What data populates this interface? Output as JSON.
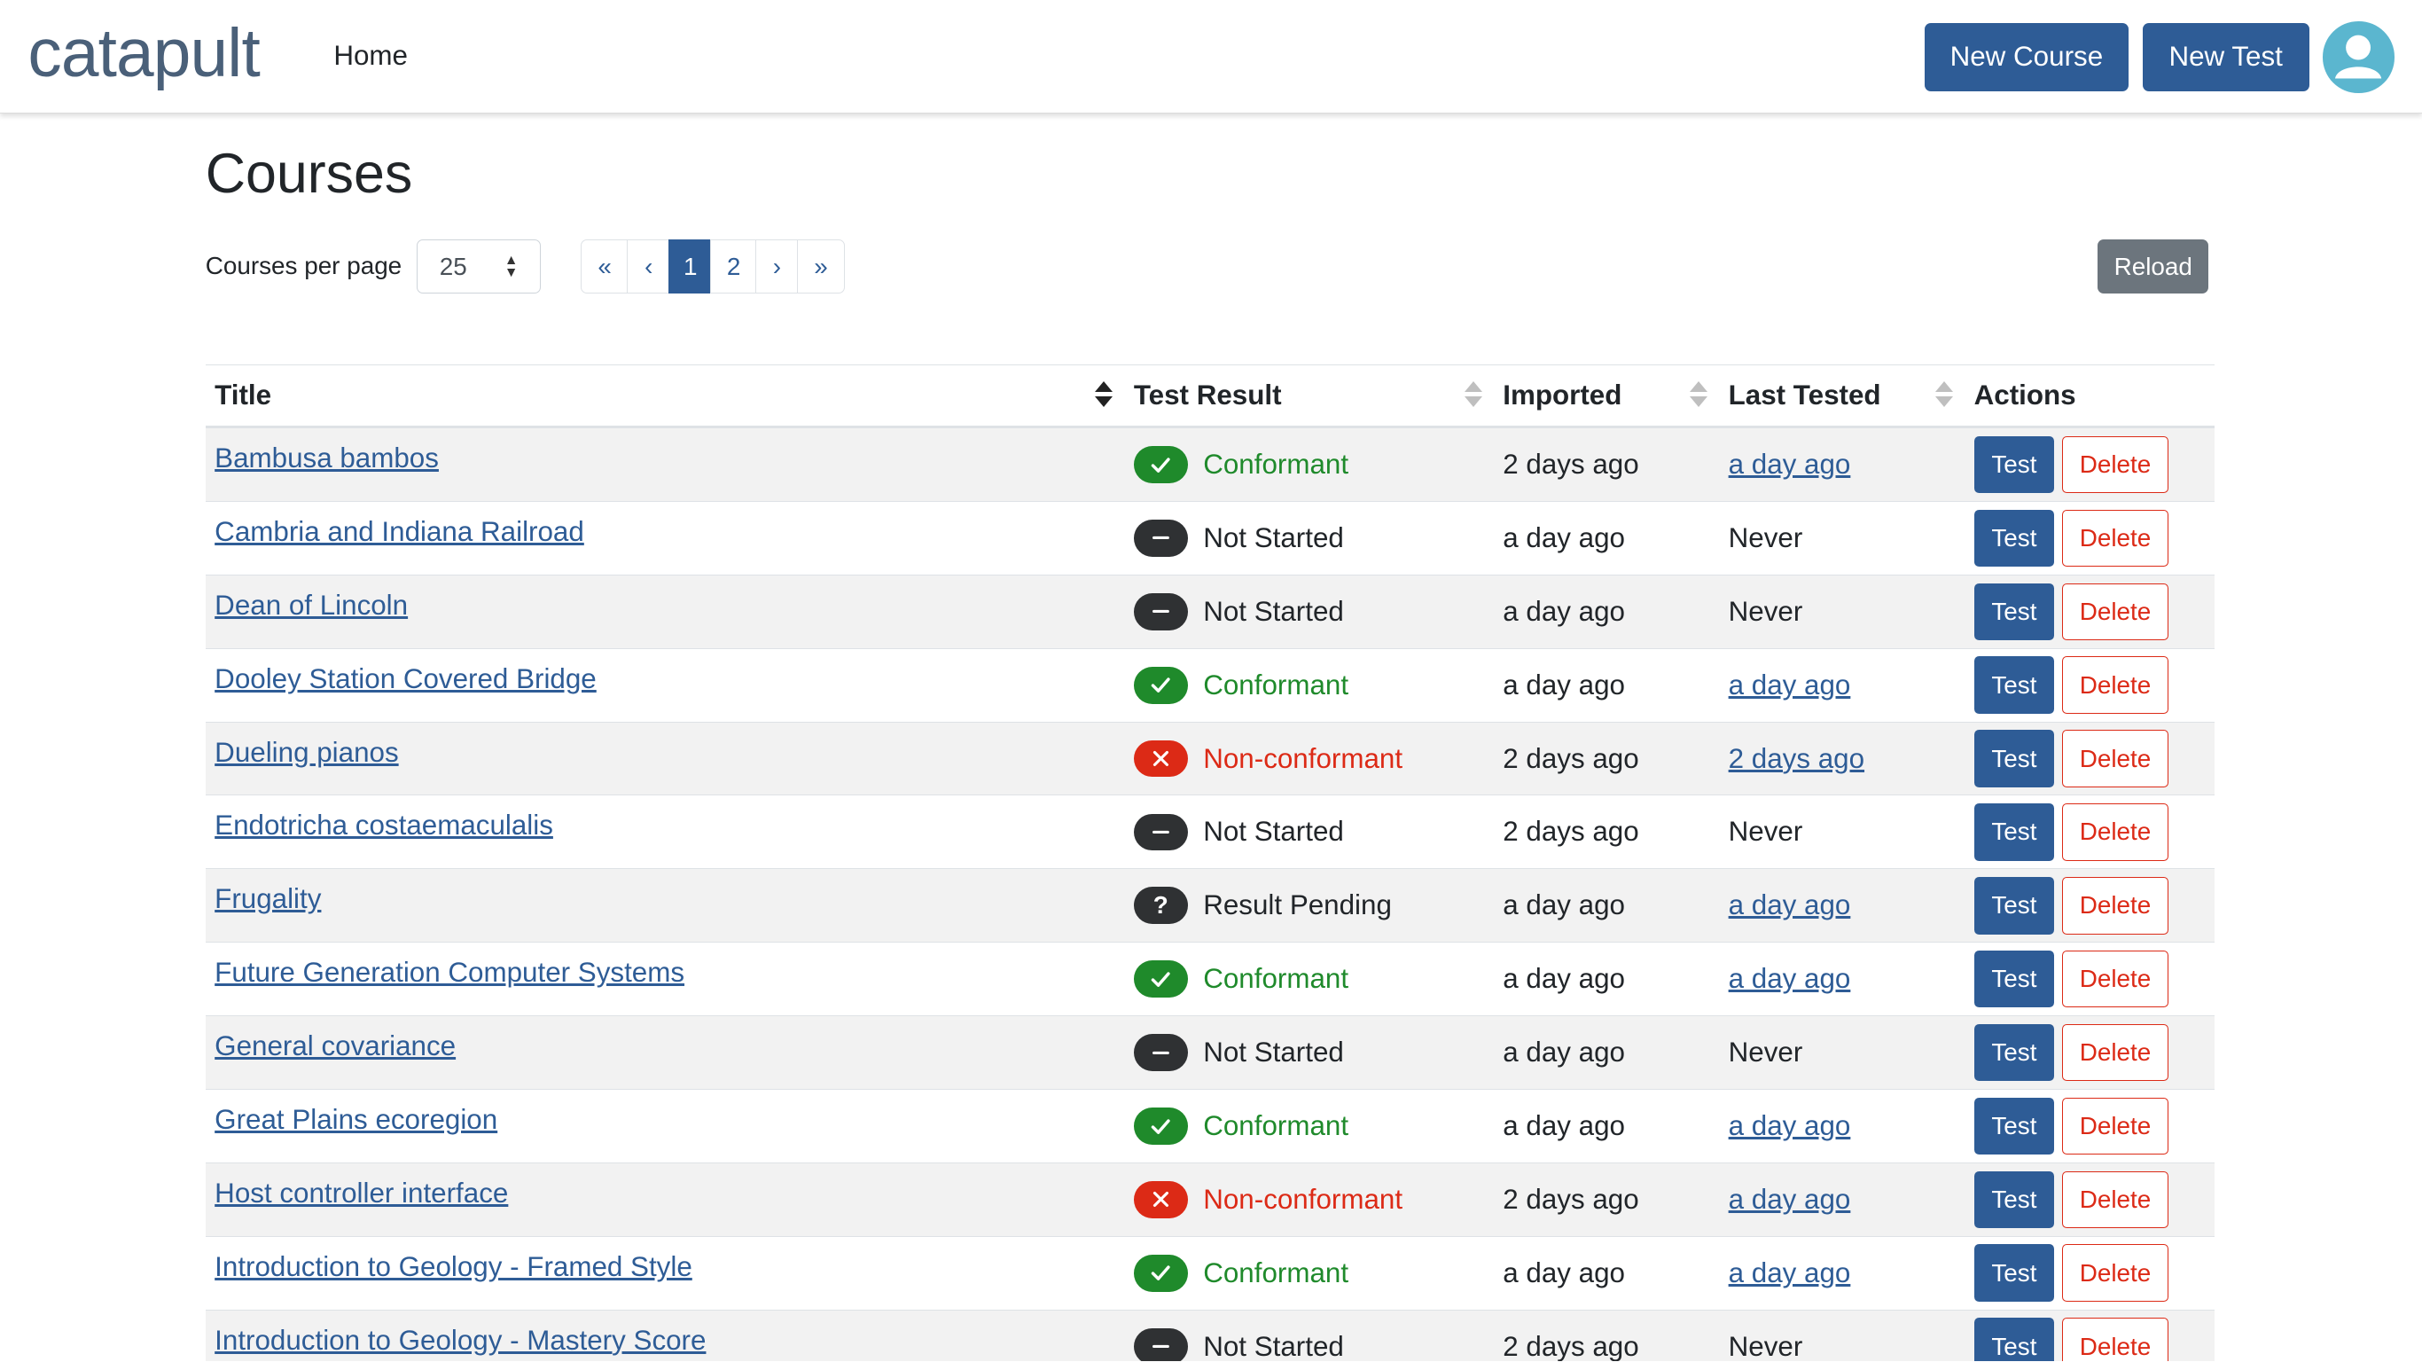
{
  "app": {
    "logo": "catapult"
  },
  "nav": {
    "home": "Home",
    "new_course": "New Course",
    "new_test": "New Test"
  },
  "page": {
    "title": "Courses"
  },
  "controls": {
    "per_page_label": "Courses per page",
    "per_page_value": "25",
    "pagination": {
      "first": "«",
      "prev": "‹",
      "pages": [
        "1",
        "2"
      ],
      "current": "1",
      "next": "›",
      "last": "»"
    },
    "reload": "Reload"
  },
  "table": {
    "headers": {
      "title": "Title",
      "result": "Test Result",
      "imported": "Imported",
      "last_tested": "Last Tested",
      "actions": "Actions"
    },
    "sort": {
      "column": "Title",
      "direction": "ascending"
    },
    "action_labels": {
      "test": "Test",
      "delete": "Delete"
    },
    "rows": [
      {
        "title": "Bambusa bambos",
        "result": "Conformant",
        "status": "ok",
        "imported": "2 days ago",
        "last_tested": "a day ago",
        "last_tested_link": true
      },
      {
        "title": "Cambria and Indiana Railroad",
        "result": "Not Started",
        "status": "none",
        "imported": "a day ago",
        "last_tested": "Never",
        "last_tested_link": false
      },
      {
        "title": "Dean of Lincoln",
        "result": "Not Started",
        "status": "none",
        "imported": "a day ago",
        "last_tested": "Never",
        "last_tested_link": false
      },
      {
        "title": "Dooley Station Covered Bridge",
        "result": "Conformant",
        "status": "ok",
        "imported": "a day ago",
        "last_tested": "a day ago",
        "last_tested_link": true
      },
      {
        "title": "Dueling pianos",
        "result": "Non-conformant",
        "status": "fail",
        "imported": "2 days ago",
        "last_tested": "2 days ago",
        "last_tested_link": true
      },
      {
        "title": "Endotricha costaemaculalis",
        "result": "Not Started",
        "status": "none",
        "imported": "2 days ago",
        "last_tested": "Never",
        "last_tested_link": false
      },
      {
        "title": "Frugality",
        "result": "Result Pending",
        "status": "pending",
        "imported": "a day ago",
        "last_tested": "a day ago",
        "last_tested_link": true
      },
      {
        "title": "Future Generation Computer Systems",
        "result": "Conformant",
        "status": "ok",
        "imported": "a day ago",
        "last_tested": "a day ago",
        "last_tested_link": true
      },
      {
        "title": "General covariance",
        "result": "Not Started",
        "status": "none",
        "imported": "a day ago",
        "last_tested": "Never",
        "last_tested_link": false
      },
      {
        "title": "Great Plains ecoregion",
        "result": "Conformant",
        "status": "ok",
        "imported": "a day ago",
        "last_tested": "a day ago",
        "last_tested_link": true
      },
      {
        "title": "Host controller interface",
        "result": "Non-conformant",
        "status": "fail",
        "imported": "2 days ago",
        "last_tested": "a day ago",
        "last_tested_link": true
      },
      {
        "title": "Introduction to Geology - Framed Style",
        "result": "Conformant",
        "status": "ok",
        "imported": "a day ago",
        "last_tested": "a day ago",
        "last_tested_link": true
      },
      {
        "title": "Introduction to Geology - Mastery Score",
        "result": "Not Started",
        "status": "none",
        "imported": "2 days ago",
        "last_tested": "Never",
        "last_tested_link": false
      }
    ]
  },
  "colors": {
    "primary": "#2e5c96",
    "success": "#1f8a2b",
    "danger": "#dc2a16",
    "secondary": "#6c757d",
    "avatar": "#5bb6cf"
  },
  "icons": {
    "ok": "check-icon",
    "fail": "x-icon",
    "none": "minus-icon",
    "pending": "question-icon"
  }
}
